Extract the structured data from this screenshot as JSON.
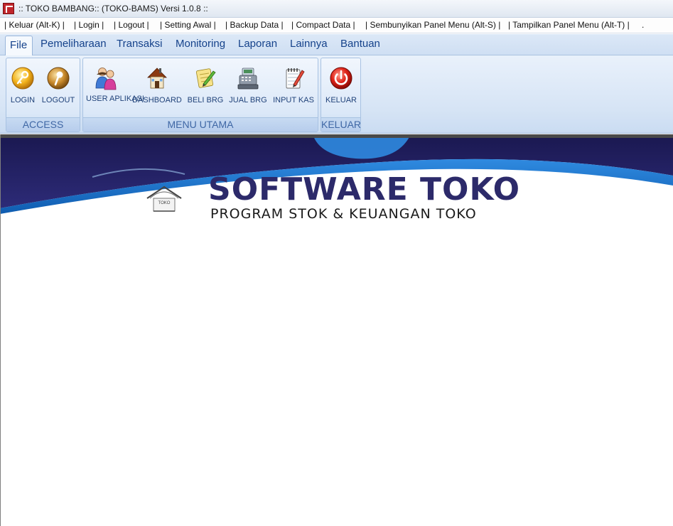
{
  "window": {
    "title": ":: TOKO BAMBANG:: (TOKO-BAMS) Versi 1.0.8 ::"
  },
  "menubar": {
    "items": [
      "| Keluar (Alt-K) |",
      "| Login |",
      "| Logout |",
      "| Setting Awal |",
      "| Backup Data |",
      "| Compact Data |",
      "| Sembunyikan Panel Menu (Alt-S) |",
      "| Tampilkan Panel Menu (Alt-T) |",
      "."
    ]
  },
  "tabs": {
    "items": [
      "File",
      "Pemeliharaan",
      "Transaksi",
      "Monitoring",
      "Laporan",
      "Lainnya",
      "Bantuan"
    ],
    "active": "File"
  },
  "ribbon": {
    "groups": [
      {
        "title": "ACCESS",
        "buttons": [
          {
            "label": "LOGIN",
            "icon": "key-icon"
          },
          {
            "label": "LOGOUT",
            "icon": "key-icon"
          }
        ]
      },
      {
        "title": "MENU UTAMA",
        "buttons": [
          {
            "label": "USER APLIKASI",
            "icon": "users-icon"
          },
          {
            "label": "DASHBOARD",
            "icon": "house-icon"
          },
          {
            "label": "BELI BRG",
            "icon": "notepad-pencil-icon"
          },
          {
            "label": "JUAL BRG",
            "icon": "cash-register-icon"
          },
          {
            "label": "INPUT KAS",
            "icon": "notebook-pencil-icon"
          }
        ]
      },
      {
        "title": "KELUAR",
        "buttons": [
          {
            "label": "KELUAR",
            "icon": "power-icon"
          }
        ]
      }
    ]
  },
  "banner": {
    "title": "SOFTWARE TOKO",
    "subtitle": "PROGRAM  STOK & KEUANGAN  TOKO",
    "logo_text": "TOKO"
  },
  "colors": {
    "ribbon_text": "#15428b",
    "banner_navy": "#2c2a6a",
    "banner_blue": "#1e6fc4"
  }
}
